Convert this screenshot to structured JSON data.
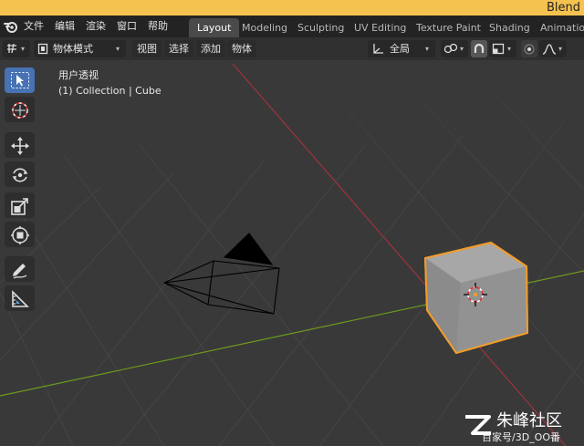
{
  "window": {
    "title": "Blend"
  },
  "menu": {
    "items": [
      "文件",
      "编辑",
      "渲染",
      "窗口",
      "帮助"
    ]
  },
  "workspaces": {
    "tabs": [
      "Layout",
      "Modeling",
      "Sculpting",
      "UV Editing",
      "Texture Paint",
      "Shading",
      "Animation"
    ],
    "active_index": 0
  },
  "header": {
    "mode_label": "物体模式",
    "view_label": "视图",
    "select_label": "选择",
    "add_label": "添加",
    "object_label": "物体",
    "orientation_label": "全局"
  },
  "viewport": {
    "view_name": "用户透视",
    "collection_info": "(1) Collection | Cube"
  },
  "watermark": {
    "brand": "朱峰社区",
    "sub": "百家号/3D_OO番"
  },
  "colors": {
    "title_bar": "#f5c24f",
    "accent_active_tool": "#4772b3",
    "selection_outline": "#f29c2a",
    "x_axis": "#a0333d",
    "y_axis": "#6c9b1c",
    "viewport_bg": "#393939"
  },
  "icons": {
    "toolbar": [
      "cursor-select-icon",
      "3d-cursor-icon",
      "move-icon",
      "rotate-icon",
      "scale-icon",
      "transform-icon",
      "annotate-icon",
      "measure-icon"
    ]
  }
}
